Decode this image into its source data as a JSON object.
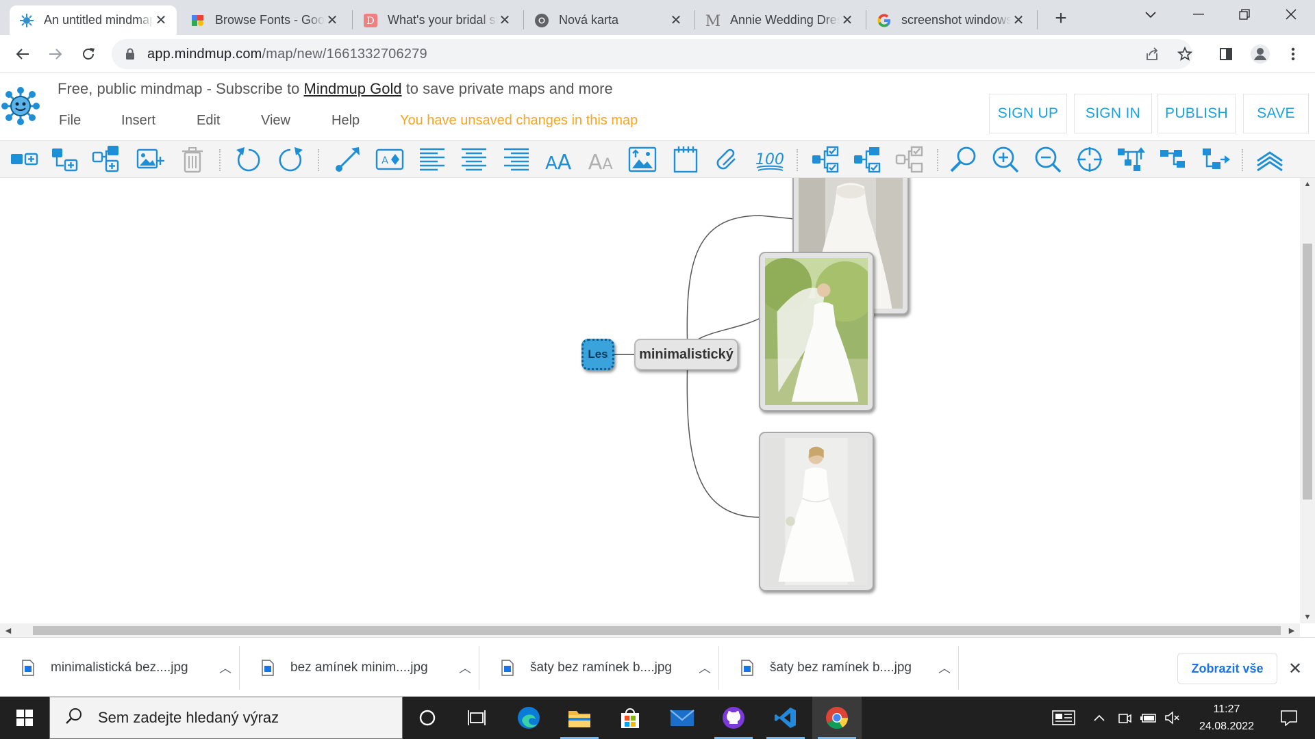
{
  "browser": {
    "tabs": [
      {
        "title": "An untitled mindmap",
        "icon": "mindmup-icon",
        "active": true
      },
      {
        "title": "Browse Fonts - Google Fonts",
        "icon": "google-fonts-icon",
        "active": false
      },
      {
        "title": "What's your bridal style",
        "icon": "d-letter-icon",
        "active": false
      },
      {
        "title": "Nová karta",
        "icon": "chrome-icon",
        "active": false
      },
      {
        "title": "Annie Wedding Dress",
        "icon": "m-letter-icon",
        "active": false
      },
      {
        "title": "screenshot windows",
        "icon": "google-icon",
        "active": false
      }
    ],
    "new_tab_label": "+",
    "url_host": "app.mindmup.com",
    "url_path": "/map/new/1661332706279"
  },
  "header": {
    "promo_before": "Free, public mindmap - Subscribe to ",
    "promo_link": "Mindmup Gold",
    "promo_after": " to save private maps and more",
    "menu": [
      "File",
      "Insert",
      "Edit",
      "View",
      "Help"
    ],
    "unsaved_notice": "You have unsaved changes in this map",
    "buttons": [
      "SIGN UP",
      "SIGN IN",
      "PUBLISH",
      "SAVE"
    ]
  },
  "colors": {
    "accent": "#1ba1e2",
    "icon_blue": "#1e8fd6",
    "unsaved": "#f5a623",
    "root_node": "#3aa3dc"
  },
  "toolbar_icons": [
    "add-child-node-icon",
    "add-sibling-node-icon",
    "insert-parent-node-icon",
    "add-image-icon",
    "delete-icon",
    "undo-icon",
    "redo-icon",
    "add-link-icon",
    "text-style-icon",
    "align-left-icon",
    "align-center-icon",
    "align-right-icon",
    "increase-font-icon",
    "decrease-font-icon",
    "node-image-icon",
    "attachment-note-icon",
    "hyperlink-icon",
    "progress-icon",
    "collapse-children-icon",
    "expand-children-icon",
    "toggle-collapse-icon",
    "search-icon",
    "zoom-in-icon",
    "zoom-out-icon",
    "reset-view-icon",
    "layout-top-down-icon",
    "layout-standard-icon",
    "layout-right-icon",
    "collapse-toolbar-icon"
  ],
  "mindmap": {
    "root": "Les",
    "branch": "minimalistický",
    "image_nodes": [
      "wedding-dress-photo-1",
      "wedding-dress-photo-2",
      "wedding-dress-photo-3"
    ]
  },
  "downloads": {
    "items": [
      "minimalistická bez....jpg",
      "bez amínek minim....jpg",
      "šaty bez ramínek b....jpg",
      "šaty bez ramínek b....jpg"
    ],
    "show_all": "Zobrazit vše"
  },
  "taskbar": {
    "search_placeholder": "Sem zadejte hledaný výraz",
    "apps": [
      "cortana-icon",
      "task-view-icon",
      "edge-icon",
      "file-explorer-icon",
      "microsoft-store-icon",
      "mail-icon",
      "github-desktop-icon",
      "vscode-icon",
      "chrome-icon"
    ],
    "time": "11:27",
    "date": "24.08.2022"
  }
}
